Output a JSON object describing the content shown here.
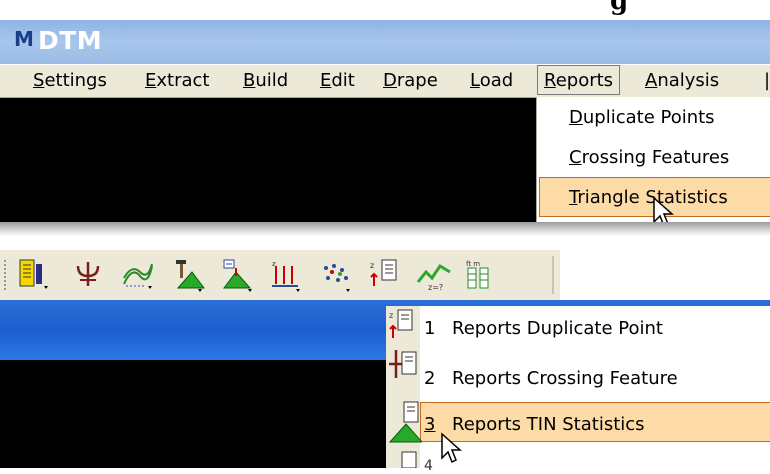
{
  "heading_fragment": "g",
  "window": {
    "title": "DTM",
    "icon_glyph": "Ⓜ"
  },
  "menubar": {
    "items": [
      "Settings",
      "Extract",
      "Build",
      "Edit",
      "Drape",
      "Load",
      "Reports",
      "Analysis"
    ],
    "active": "Reports"
  },
  "reports_menu": {
    "items": [
      "Duplicate Points",
      "Crossing Features",
      "Triangle Statistics"
    ],
    "highlighted": "Triangle Statistics"
  },
  "toolbar": {
    "icons": [
      "reports-icon",
      "crossing-icon",
      "contours-icon",
      "tin-build-icon",
      "drape-icon",
      "extract-icon",
      "points-icon",
      "duplicate-points-report-icon",
      "profile-icon",
      "statistics-icon"
    ]
  },
  "tool_popup": {
    "items": [
      {
        "num": "1",
        "label": "Reports Duplicate Point"
      },
      {
        "num": "2",
        "label": "Reports Crossing Feature"
      },
      {
        "num": "3",
        "label": "Reports TIN Statistics"
      }
    ],
    "highlighted": "Reports TIN Statistics"
  },
  "colors": {
    "highlight": "#fcdba6",
    "highlight_border": "#c46a1f",
    "titlebar": "#9cbce6",
    "menubar": "#ece9d8",
    "blue_bar": "#1c5ed0"
  }
}
